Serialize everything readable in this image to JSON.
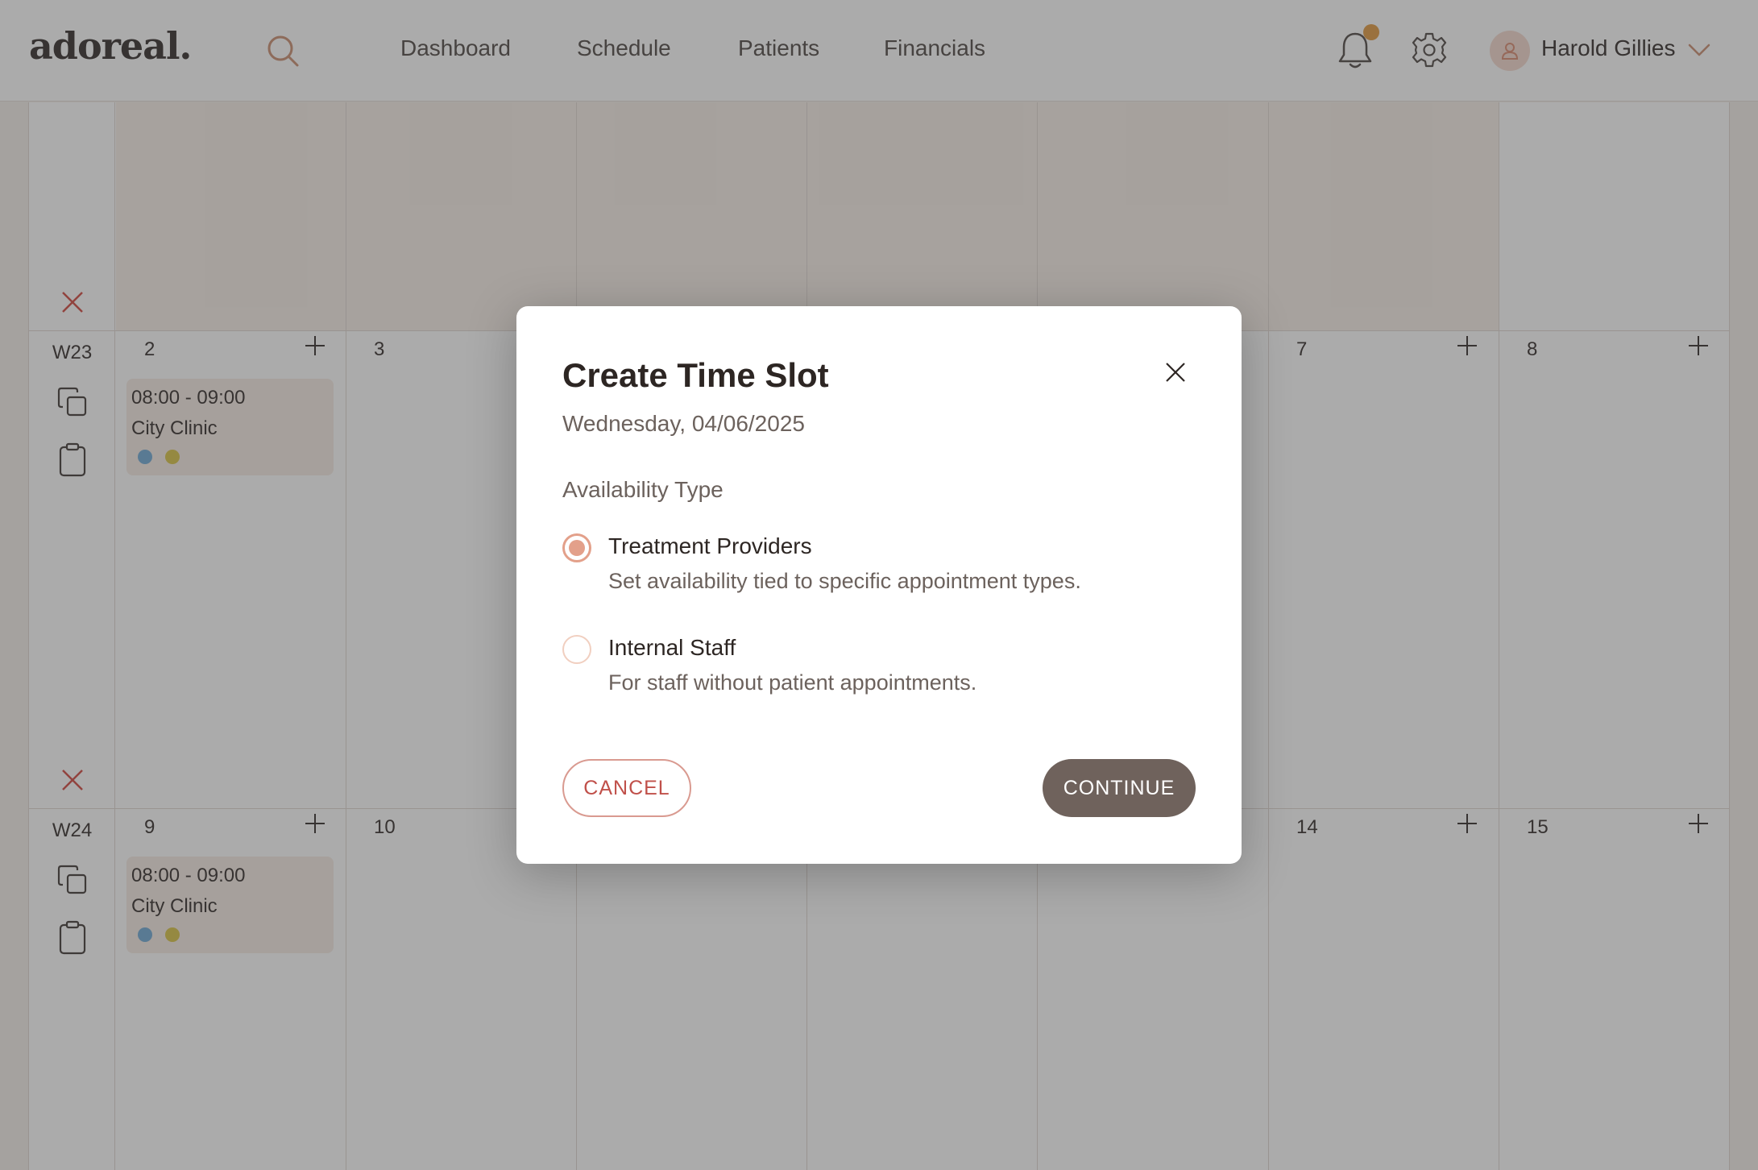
{
  "header": {
    "logo": "adoreal.",
    "nav": [
      "Dashboard",
      "Schedule",
      "Patients",
      "Financials"
    ],
    "user": {
      "name": "Harold Gillies"
    },
    "icons": [
      "search-icon",
      "bell-icon",
      "gear-icon",
      "user-icon",
      "chevron-down-icon"
    ]
  },
  "calendar": {
    "weeks": [
      {
        "label": "W23",
        "days": [
          "2",
          "3",
          "",
          "",
          "",
          "7",
          "8"
        ],
        "slot": {
          "time": "08:00 - 09:00",
          "location": "City Clinic"
        }
      },
      {
        "label": "W24",
        "days": [
          "9",
          "10",
          "",
          "",
          "",
          "14",
          "15"
        ],
        "slot": {
          "time": "08:00 - 09:00",
          "location": "City Clinic"
        }
      }
    ],
    "dot_colors": [
      "#6aa7d4",
      "#d8c23e"
    ]
  },
  "modal": {
    "title": "Create Time Slot",
    "date": "Wednesday, 04/06/2025",
    "section_label": "Availability Type",
    "options": [
      {
        "label": "Treatment Providers",
        "description": "Set availability tied to specific appointment types.",
        "selected": true
      },
      {
        "label": "Internal Staff",
        "description": "For staff without patient appointments.",
        "selected": false
      }
    ],
    "cancel_label": "CANCEL",
    "continue_label": "CONTINUE"
  },
  "colors": {
    "accent": "#e3a08a",
    "primary_button": "#6f625c",
    "cancel_text": "#c0504a",
    "notification_dot": "#e0953a"
  }
}
